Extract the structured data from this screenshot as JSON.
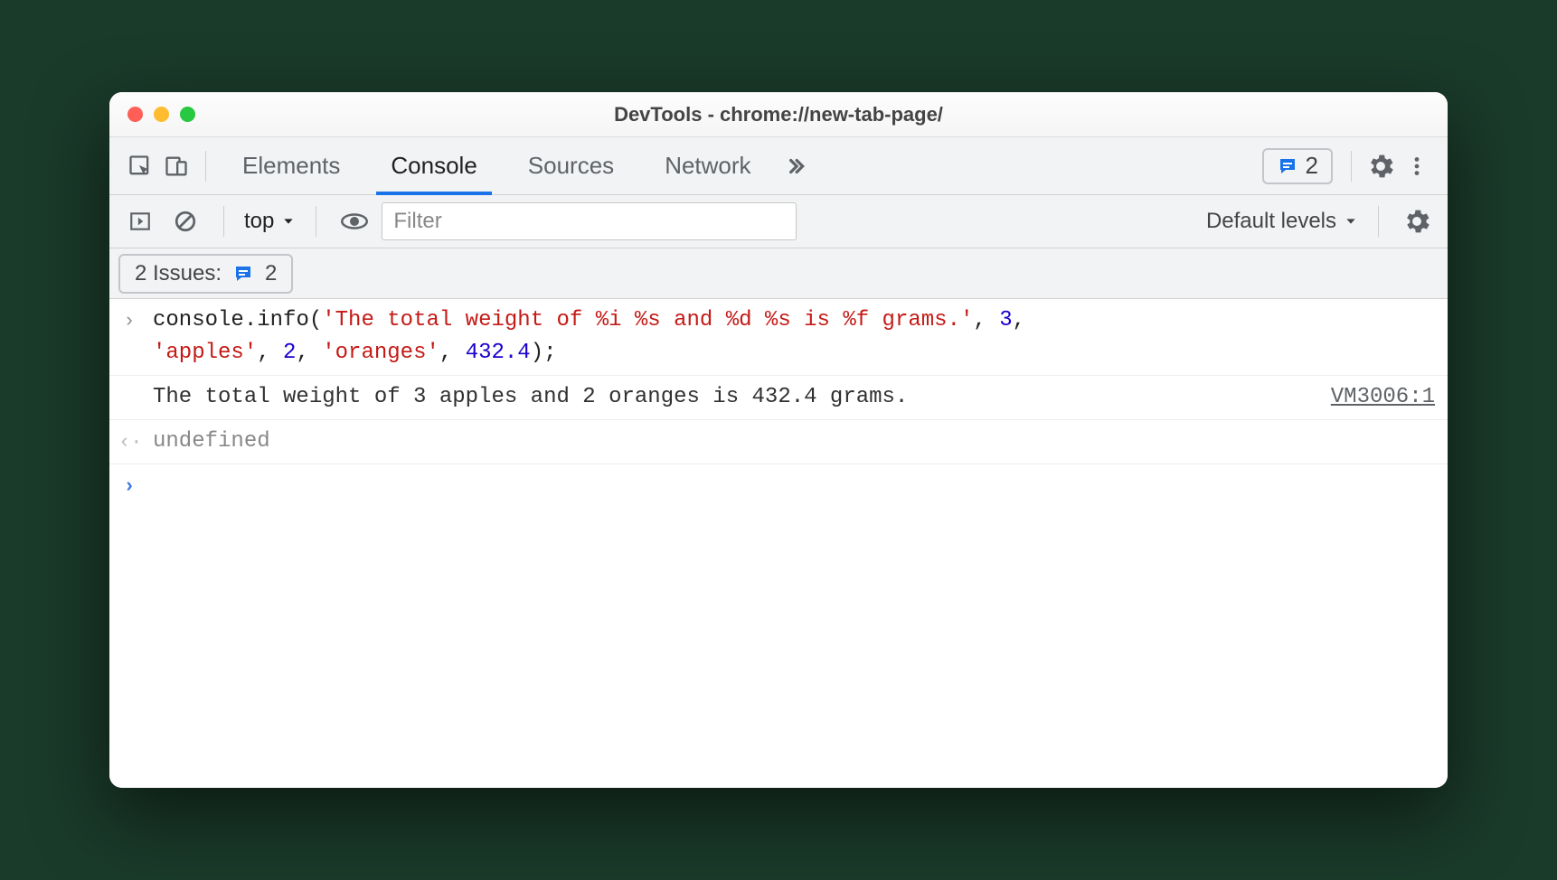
{
  "window_title": "DevTools - chrome://new-tab-page/",
  "tabs": [
    "Elements",
    "Console",
    "Sources",
    "Network"
  ],
  "active_tab": "Console",
  "issues_badge_count": "2",
  "toolbar": {
    "context_label": "top",
    "filter_placeholder": "Filter",
    "levels_label": "Default levels"
  },
  "issues_bar": {
    "label": "2 Issues:",
    "count": "2"
  },
  "console": {
    "input": {
      "obj": "console",
      "method": "info",
      "arg_str": "'The total weight of %i %s and %d %s is %f grams.'",
      "arg_num1": "3",
      "arg_str2": "'apples'",
      "arg_num2": "2",
      "arg_str3": "'oranges'",
      "arg_num3": "432.4"
    },
    "output_text": "The total weight of 3 apples and 2 oranges is 432.4 grams.",
    "output_source": "VM3006:1",
    "return_value": "undefined"
  }
}
